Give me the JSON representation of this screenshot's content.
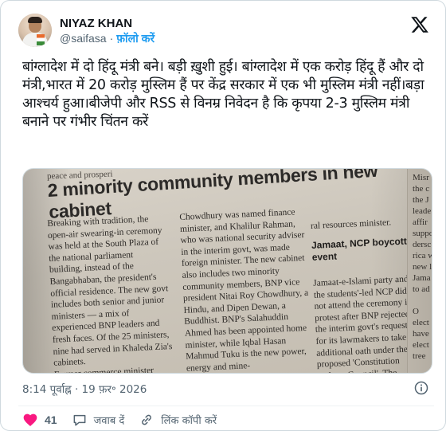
{
  "author": {
    "name": "NIYAZ KHAN",
    "handle": "@saifasa",
    "separator": "·",
    "follow_label": "फ़ॉलो करें"
  },
  "post": {
    "text": "बांग्लादेश में दो हिंदू मंत्री बने। बड़ी ख़ुशी हुई। बांग्लादेश में एक करोड़ हिंदू हैं और दो मंत्री,भारत में 20 करोड़ मुस्लिम हैं पर केंद्र सरकार में एक भी मुस्लिम मंत्री नहीं।बड़ा आश्चर्य हुआ।बीजेपी और RSS से विनम्र निवेदन है कि कृपया 2-3 मुस्लिम मंत्री बनाने पर गंभीर चिंतन करें",
    "timestamp": "8:14 पूर्वाह्न · 19 फ़र॰ 2026"
  },
  "photo": {
    "top_fragment": "peace and prosperi",
    "headline": "2 minority community members in new cabinet",
    "col1": "Breaking with tradition, the open-air swearing-in ceremony was held at the South Plaza of the national parliament building, instead of the Bangabhaban, the president's official residence. The new govt includes both senior and junior ministers — a mix of experienced BNP leaders and fresh faces. Of the 25 ministers, nine had served in Khaleda Zia's cabinets.\n   Former commerce minister Amir Khasru Mahmud",
    "col2": "Chowdhury was named finance minister, and Khalilur Rahman, who was national security adviser in the interim govt, was made foreign minister. The new cabinet also includes two minority community members, BNP vice president Nitai Roy Chowdhury, a Hindu, and Dipen Dewan, a Buddhist. BNP's Salahuddin Ahmed has been appointed home minister, while Iqbal Hasan Mahmud Tuku is the new power, energy and mine-",
    "col3_top": "ral resources minister.",
    "col3_subhead": "Jamaat, NCP boycott event",
    "col3_body": "Jamaat-e-Islami party and the students'-led NCP did not attend the ceremony in protest after BNP rejected the interim govt's request for its lawmakers to take an additional oath under the proposed 'Constitution Reform Council'. The council intends to amend the constitution following the referendum held alongside the elections. AGENCIES",
    "col4": "Misr\nthe c\nthe J\nleade\naffir\nsuppo\ndersc\nrica w\nnew l\nJama\nto ad\n\nO\nelect\nhave\nelect\ntree"
  },
  "actions": {
    "like_count": "41",
    "reply_label": "जवाब दें",
    "copy_link_label": "लिंक कॉपी करें"
  },
  "icons": {
    "brand": "x-logo-icon",
    "info": "info-icon",
    "like": "heart-icon",
    "reply": "speech-bubble-icon",
    "link": "link-icon"
  },
  "colors": {
    "accent": "#1d9bf0",
    "like": "#f91880",
    "text": "#0f1419",
    "secondary": "#536471"
  }
}
